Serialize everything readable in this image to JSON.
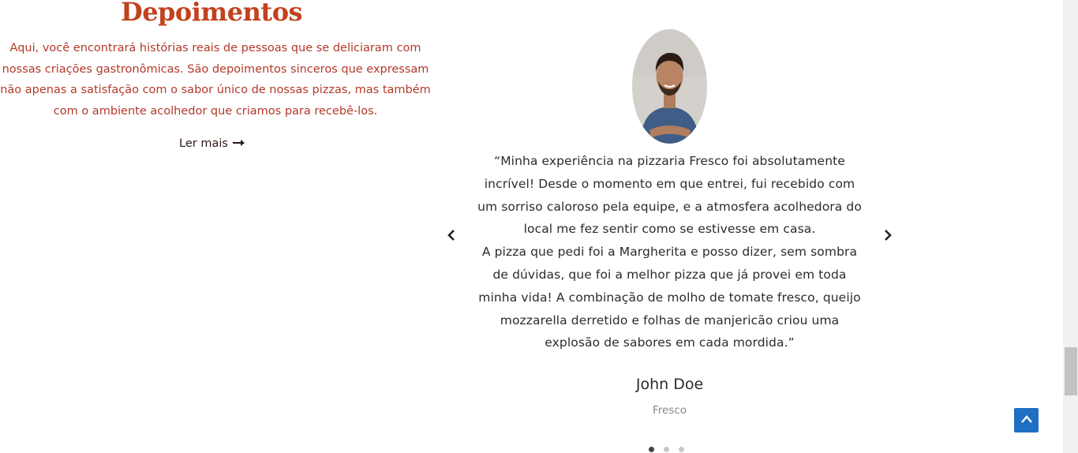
{
  "testimonials": {
    "title": "Depoimentos",
    "description": "Aqui, você encontrará histórias reais de pessoas que se deliciaram com nossas criações gastronômicas. São depoimentos sinceros que expressam não apenas a satisfação com o sabor único de nossas pizzas, mas também com o ambiente acolhedor que criamos para recebê-los.",
    "read_more_label": "Ler mais",
    "read_more_icon": "arrow-right-icon"
  },
  "slider": {
    "quote_paragraphs": [
      "“Minha experiência na pizzaria Fresco foi absolutamente incrível! Desde o momento em que entrei, fui recebido com um sorriso caloroso pela equipe, e a atmosfera acolhedora do local me fez sentir como se estivesse em casa.",
      "A pizza que pedi foi a Margherita e posso dizer, sem sombra de dúvidas, que foi a melhor pizza que já provei em toda minha vida! A combinação de molho de tomate fresco, queijo mozzarella derretido e folhas de manjericão criou uma explosão de sabores em cada mordida.”"
    ],
    "author_name": "John Doe",
    "author_company": "Fresco",
    "active_slide": 1,
    "slide_count": 3,
    "prev_icon": "chevron-left-icon",
    "next_icon": "chevron-right-icon"
  },
  "scroll_top_icon": "arrow-up-icon",
  "colors": {
    "title": "#c2411e",
    "description": "#b3392a",
    "accent_button": "#1f6fc4"
  }
}
